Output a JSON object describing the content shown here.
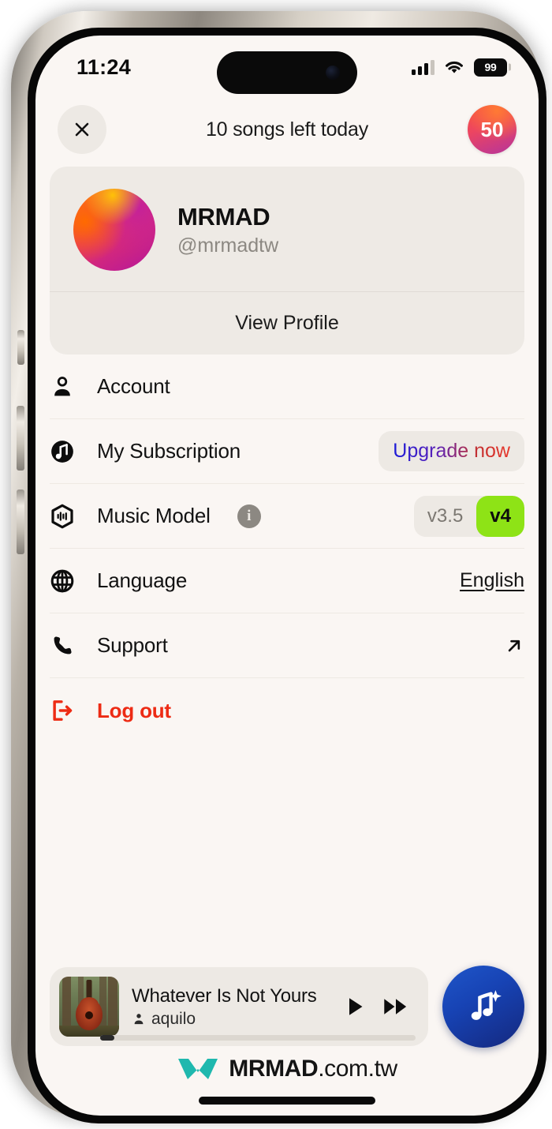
{
  "status_bar": {
    "time": "11:24",
    "battery_level": "99",
    "signal_icon": "cellular-signal-icon",
    "wifi_icon": "wifi-icon",
    "battery_icon": "battery-icon"
  },
  "top_bar": {
    "close_icon": "close-icon",
    "title": "10 songs left today",
    "credits": "50"
  },
  "profile": {
    "avatar_icon": "user-avatar",
    "display_name": "MRMAD",
    "handle": "@mrmadtw",
    "view_profile_label": "View Profile"
  },
  "menu": {
    "items": [
      {
        "key": "account",
        "label": "Account",
        "icon": "person-icon",
        "value": "",
        "accessory": "none"
      },
      {
        "key": "my-subscription",
        "label": "My Subscription",
        "icon": "music-note-circle-icon",
        "value": "Upgrade now",
        "accessory": "upgrade-pill"
      },
      {
        "key": "music-model",
        "label": "Music Model",
        "icon": "music-model-hexagon-icon",
        "info_icon": "info-icon",
        "accessory": "segmented",
        "options": [
          "v3.5",
          "v4"
        ],
        "selected": "v4"
      },
      {
        "key": "language",
        "label": "Language",
        "icon": "globe-icon",
        "value": "English",
        "accessory": "link-value"
      },
      {
        "key": "support",
        "label": "Support",
        "icon": "phone-icon",
        "value": "",
        "accessory": "external-link-arrow"
      },
      {
        "key": "log-out",
        "label": "Log out",
        "icon": "logout-icon",
        "value": "",
        "accessory": "none"
      }
    ]
  },
  "player": {
    "artwork_icon": "album-art-guitar-forest",
    "title": "Whatever Is Not Yours",
    "artist": "aquilo",
    "artist_icon": "person-small-icon",
    "play_icon": "play-icon",
    "next_icon": "fast-forward-icon",
    "progress_percent": 4
  },
  "fab": {
    "icon": "create-music-sparkle-icon"
  },
  "watermark": {
    "logo_icon": "mrmad-logo-icon",
    "brand": "MRMAD",
    "suffix": ".com.tw"
  },
  "colors": {
    "screen_bg": "#FAF6F3",
    "card_bg": "#EEEAE5",
    "pill_bg": "#EDE9E4",
    "accent_green": "#8EE316",
    "danger_red": "#ED2B14",
    "upgrade_gradient_start": "#1B1BD8",
    "upgrade_gradient_end": "#E8362A",
    "fab_blue": "#1743B4",
    "logo_teal": "#1FB8AE"
  }
}
